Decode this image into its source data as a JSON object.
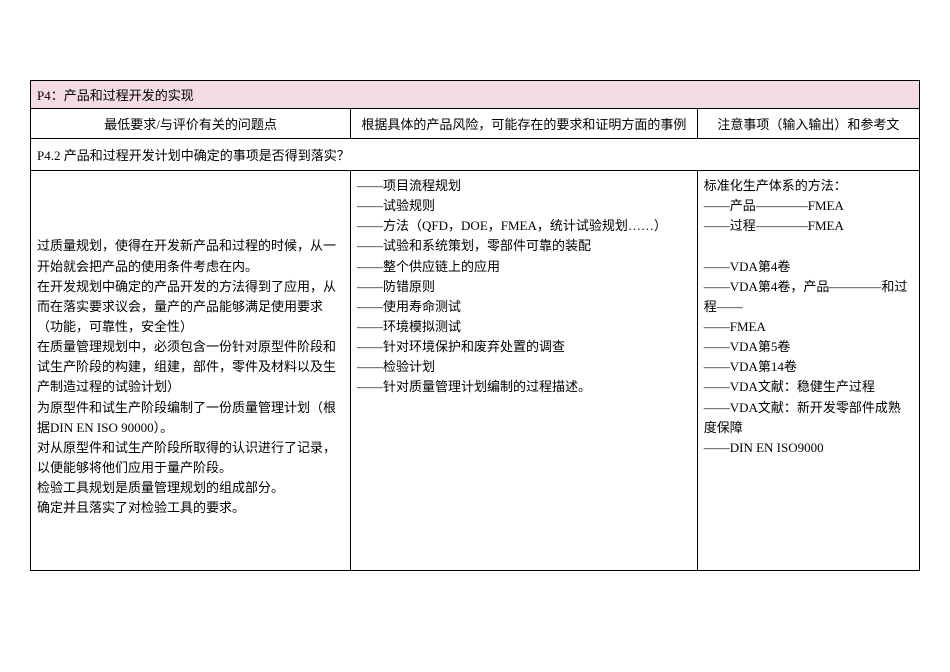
{
  "title": "P4：产品和过程开发的实现",
  "headers": {
    "col1": "最低要求/与评价有关的问题点",
    "col2": "根据具体的产品风险，可能存在的要求和证明方面的事例",
    "col3": "注意事项（输入输出）和参考文"
  },
  "subheader": "P4.2 产品和过程开发计划中确定的事项是否得到落实？",
  "cells": {
    "c1": [
      "",
      "",
      "",
      "过质量规划，使得在开发新产品和过程的时候，从一开始就会把产品的使用条件考虑在内。",
      "在开发规划中确定的产品开发的方法得到了应用，从而在落实要求议会，量产的产品能够满足使用要求（功能，可靠性，安全性）",
      "在质量管理规划中，必须包含一份针对原型件阶段和试生产阶段的构建，组建，部件，零件及材料以及生产制造过程的试验计划）",
      "为原型件和试生产阶段编制了一份质量管理计划（根据DIN EN ISO 90000）。",
      "对从原型件和试生产阶段所取得的认识进行了记录，以便能够将他们应用于量产阶段。",
      "检验工具规划是质量管理规划的组成部分。",
      "确定并且落实了对检验工具的要求。"
    ],
    "c2": [
      "——项目流程规划",
      "——试验规则",
      "——方法（QFD，DOE，FMEA，统计试验规划……）",
      "——试验和系统策划，零部件可靠的装配",
      "——整个供应链上的应用",
      "——防错原则",
      "——使用寿命测试",
      "——环境模拟测试",
      "——针对环境保护和废弃处置的调查",
      "——检验计划",
      "——针对质量管理计划编制的过程描述。"
    ],
    "c3": [
      "标准化生产体系的方法：",
      "——产品————FMEA",
      "——过程————FMEA",
      "",
      "——VDA第4卷",
      "——VDA第4卷，产品————和过程——",
      "——FMEA",
      "——VDA第5卷",
      "——VDA第14卷",
      "——VDA文献：稳健生产过程",
      "——VDA文献：新开发零部件成熟度保障",
      "——DIN EN ISO9000"
    ]
  }
}
